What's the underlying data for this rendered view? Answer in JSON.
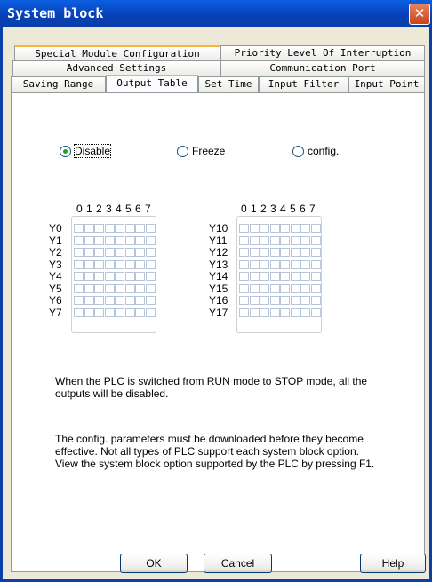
{
  "window": {
    "title": "System block",
    "close_label": "✕"
  },
  "tabs": {
    "row1": [
      "Special Module Configuration",
      "Priority Level Of Interruption"
    ],
    "row2": [
      "Advanced Settings",
      "Communication Port"
    ],
    "row3": [
      "Saving Range",
      "Output Table",
      "Set Time",
      "Input Filter",
      "Input Point"
    ],
    "active": "Output Table"
  },
  "mode": {
    "options": [
      "Disable",
      "Freeze",
      "config."
    ],
    "selected": "Disable"
  },
  "bit_header": "0 1 2 3 4 5 6 7",
  "output_tables": [
    {
      "rows": [
        "Y0",
        "Y1",
        "Y2",
        "Y3",
        "Y4",
        "Y5",
        "Y6",
        "Y7"
      ]
    },
    {
      "rows": [
        "Y10",
        "Y11",
        "Y12",
        "Y13",
        "Y14",
        "Y15",
        "Y16",
        "Y17"
      ]
    }
  ],
  "description": "When the PLC is switched from RUN mode to STOP mode, all the outputs will be disabled.",
  "description_lines": [
    "When the PLC is switched from RUN mode to STOP mode, all the",
    "outputs will be disabled."
  ],
  "note_lines": [
    "The config. parameters must be downloaded before they become",
    "effective. Not all types of PLC support each system block option.",
    "View the system block option supported by the PLC by pressing F1."
  ],
  "buttons": {
    "ok": "OK",
    "cancel": "Cancel",
    "help": "Help"
  }
}
